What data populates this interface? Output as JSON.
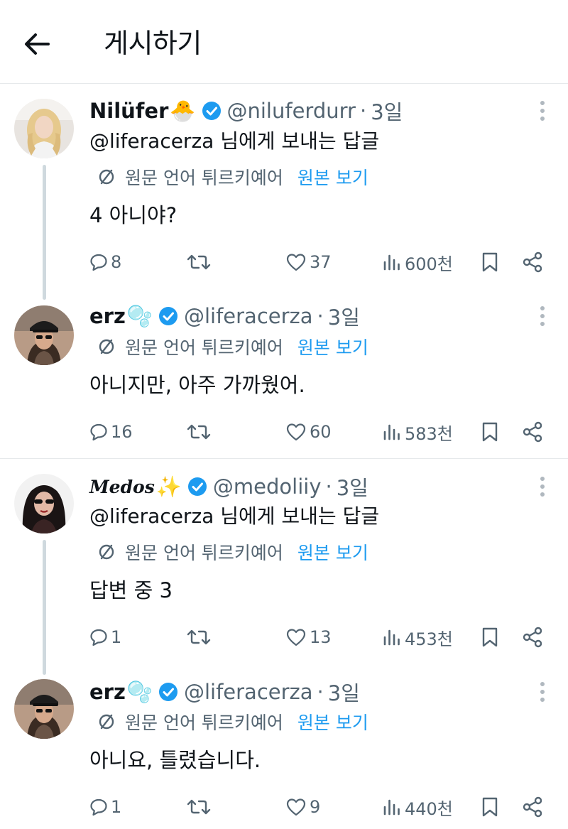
{
  "header": {
    "title": "게시하기",
    "back_icon": "arrow-left-icon"
  },
  "translation": {
    "label": "원문 언어 튀르키예어",
    "link": "원본 보기"
  },
  "colors": {
    "accent": "#1d9bf0",
    "secondary_text": "#536471",
    "divider": "#e6e9eb",
    "thread_line": "#cfd9de"
  },
  "posts": [
    {
      "name": "Nilüfer",
      "emoji": "🐣",
      "handle": "@niluferdurr",
      "time": "3일",
      "reply_to_handle": "@liferacerza",
      "reply_to_suffix": " 님에게 보내는 답글",
      "text": "4 아니야?",
      "replies": "8",
      "likes": "37",
      "views": "600천"
    },
    {
      "name": "erz",
      "emoji": "🫧",
      "handle": "@liferacerza",
      "time": "3일",
      "text": "아니지만, 아주 가까웠어.",
      "replies": "16",
      "likes": "60",
      "views": "583천"
    },
    {
      "name": "Medos",
      "emoji": "✨",
      "handle": "@medoliiy",
      "time": "3일",
      "reply_to_handle": "@liferacerza",
      "reply_to_suffix": " 님에게 보내는 답글",
      "text": "답변 중 3",
      "replies": "1",
      "likes": "13",
      "views": "453천"
    },
    {
      "name": "erz",
      "emoji": "🫧",
      "handle": "@liferacerza",
      "time": "3일",
      "text": "아니요, 틀렸습니다.",
      "replies": "1",
      "likes": "9",
      "views": "440천"
    }
  ]
}
